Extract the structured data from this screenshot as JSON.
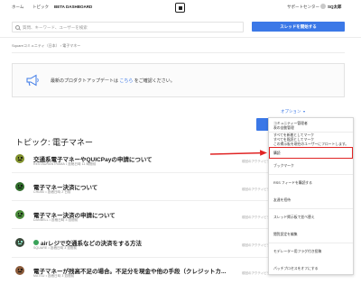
{
  "header": {
    "nav": [
      "ホーム",
      "トピック",
      "BETA DASHBOARD"
    ],
    "support_label": "サポートセンター",
    "user_name": "SQ太郎"
  },
  "search": {
    "placeholder": "質問、キーワード、ユーザーを検索",
    "start_thread_label": "スレッドを開始する"
  },
  "breadcrumb": {
    "root": "Squareコミュニティ（日本）",
    "separator": "›",
    "current": "電子マネー"
  },
  "notice": {
    "icon": "megaphone-icon",
    "text_before": "最新のプロダクトアップデートは ",
    "link": "こちら",
    "text_after": " をご確認ください。"
  },
  "options": {
    "label": "オプション",
    "menu_items": [
      "コミュニティー管理者",
      "表の自動管理",
      "すべてを新着としてマーク",
      "すべてを既読としてマーク",
      "この掲示板を現在のユーザーにフロートします。",
      "購読",
      "ブックマーク",
      "RSS フィードを購読する",
      "友達を招待",
      "スレッド掲示板で並べ替え",
      "閲覧設定を編集",
      "モデレーター用フラグ付き投稿",
      "パッチプロセスをオフにする"
    ],
    "highlighted_index": 5
  },
  "page_title": "トピック: 電子マネー",
  "topics": [
    {
      "title": "交通系電子マネーやQUICPayの申請について",
      "meta": "RESTAURANTRAMA • 投稿日時 11 時間前",
      "last_activity": "前回のアクティビティ",
      "solved": false
    },
    {
      "title": "電子マネー決済について",
      "meta": "CHIAKI • 投稿日時 2 日前",
      "last_activity": "前回のアクティビティ",
      "solved": false
    },
    {
      "title": "電子マネー決済の申請について",
      "meta": "DANBELL • 投稿日時 3 週間前",
      "last_activity": "前回のアクティビティ",
      "solved": false
    },
    {
      "title": "airレジで交通系などの決済をする方法",
      "meta": "SQUARE • 投稿日時 3 週間前",
      "last_activity": "前回のアクティビティ",
      "solved": true
    },
    {
      "title": "電子マネーが残高不足の場合。不足分を現金や他の手段（クレジットカ...",
      "meta": "MATSU • 投稿日時 3 週間前",
      "last_activity": "前回のアクティビティ",
      "solved": false
    }
  ],
  "colors": {
    "accent": "#3b78e7",
    "annotation": "#e02424",
    "solved": "#3aa35a",
    "avatars": [
      "#7f8f2c",
      "#2f6b2a",
      "#4a8a3a",
      "#3b4a3b",
      "#8a5a3a"
    ]
  }
}
